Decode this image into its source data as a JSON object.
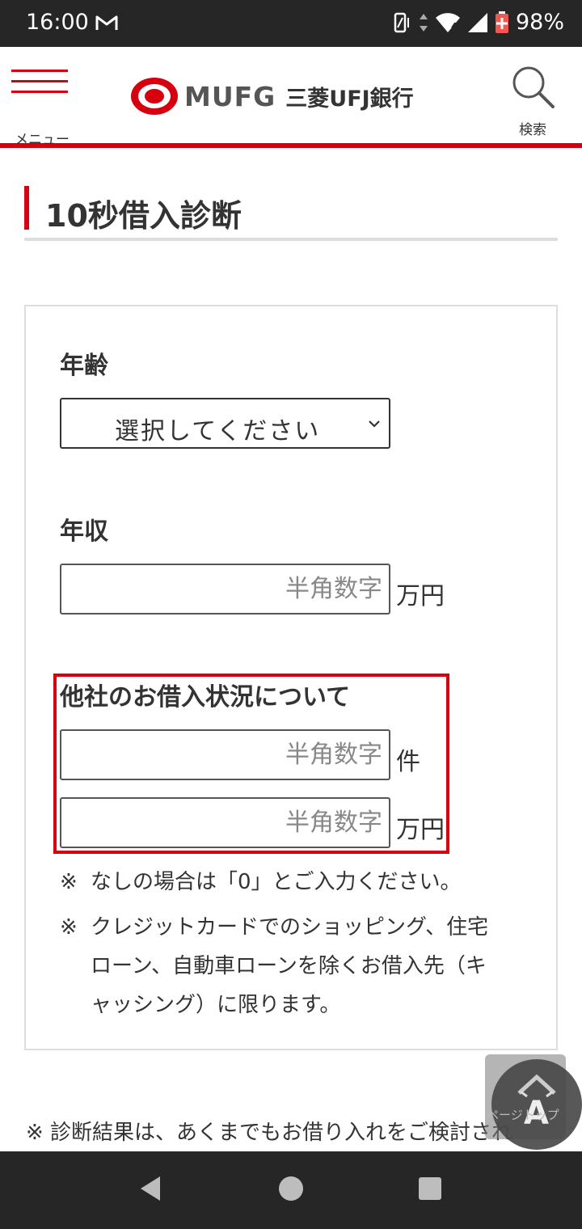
{
  "status_bar": {
    "time": "16:00",
    "battery": "98%",
    "network_badge": "4",
    "icons": [
      "gmail-icon",
      "vibrate-icon",
      "data-arrows-icon",
      "wifi-icon",
      "signal-icon",
      "battery-icon"
    ]
  },
  "header": {
    "menu_label": "メニュー",
    "logo_mufg": "MUFG",
    "logo_bank": "三菱UFJ銀行",
    "search_label": "検索"
  },
  "page_title": "10秒借入診断",
  "form": {
    "age": {
      "label": "年齢",
      "selected": "選択してください"
    },
    "income": {
      "label": "年収",
      "placeholder": "半角数字",
      "unit": "万円"
    },
    "other_loans": {
      "label": "他社のお借入状況について",
      "count_placeholder": "半角数字",
      "count_unit": "件",
      "amount_placeholder": "半角数字",
      "amount_unit": "万円"
    },
    "notes": [
      {
        "mark": "※",
        "line1": "なしの場合は「0」とご入力ください。"
      },
      {
        "mark": "※",
        "line1": "クレジットカードでのショッピング、住宅",
        "line2": "ローン、自動車ローンを除くお借入先（キ",
        "line3": "ャッシング）に限ります。"
      }
    ]
  },
  "bottom_note": "※ 診断結果は、あくまでもお借り入れをご検討され",
  "float_button": {
    "label": "ページトップ",
    "letter": "A"
  },
  "colors": {
    "accent": "#d7000f",
    "dark_bar": "#262626"
  }
}
